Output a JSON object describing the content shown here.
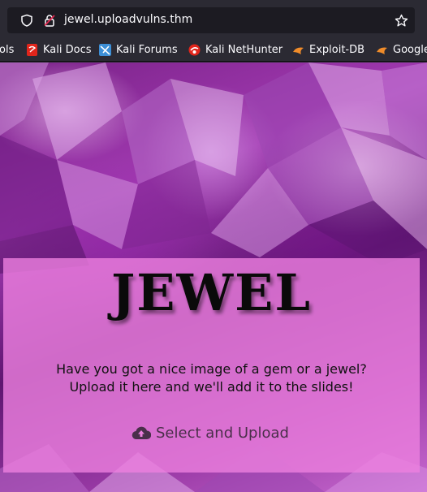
{
  "browser": {
    "url": "jewel.uploadvulns.thm",
    "bookmarks": [
      {
        "label": "ols",
        "icon": "tools-icon"
      },
      {
        "label": "Kali Docs",
        "icon": "kali-docs-icon",
        "color": "#e1251b"
      },
      {
        "label": "Kali Forums",
        "icon": "kali-forums-icon",
        "color": "#3d8fd6"
      },
      {
        "label": "Kali NetHunter",
        "icon": "kali-nethunter-icon",
        "color": "#e1251b"
      },
      {
        "label": "Exploit-DB",
        "icon": "exploit-db-icon",
        "color": "#f08c2a"
      },
      {
        "label": "Google",
        "icon": "google-hacking-icon",
        "color": "#f08c2a"
      }
    ]
  },
  "page": {
    "title": "JEWEL",
    "tagline_line1": "Have you got a nice image of a gem or a jewel?",
    "tagline_line2": "Upload it here and we'll add it to the slides!",
    "upload_label": "Select and Upload",
    "colors": {
      "panel": "#ec80de",
      "background": "#8a2a9a"
    }
  }
}
